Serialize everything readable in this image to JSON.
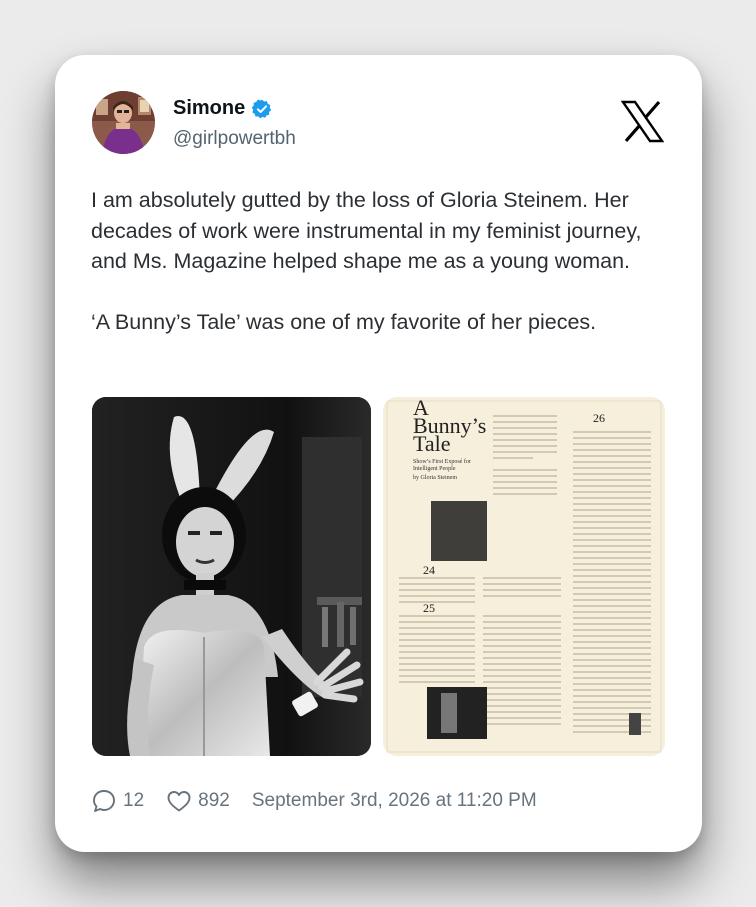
{
  "author": {
    "display_name": "Simone",
    "handle": "@girlpowertbh",
    "verified": true,
    "verified_color": "#1d9bf0"
  },
  "brand": {
    "logo_icon": "x-logo-icon"
  },
  "tweet": {
    "paragraphs": [
      "I am absolutely gutted by the loss of Gloria Steinem. Her decades of work were instrumental in my feminist journey, and Ms. Magazine helped shape me as a young woman.",
      "‘A Bunny’s Tale’ was one of my favorite of her pieces."
    ],
    "media": [
      {
        "kind": "photo",
        "description_icon": "photo-woman-in-bunny-costume"
      },
      {
        "kind": "magazine-page",
        "title_line1": "A",
        "title_line2": "Bunny’s",
        "title_line3": "Tale",
        "subtitle": "Show’s First Exposé for Intelligent People",
        "byline": "by Gloria Steinem",
        "date_24": "24",
        "date_25": "25",
        "date_26": "26"
      }
    ]
  },
  "stats": {
    "replies": "12",
    "likes": "892",
    "timestamp": "September 3rd, 2026 at 11:20 PM"
  }
}
